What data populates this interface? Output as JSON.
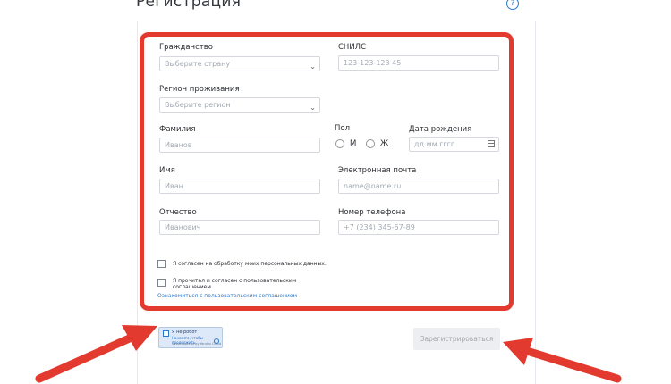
{
  "header": {
    "title": "Регистрация",
    "help_icon": "question-circle-icon",
    "help_glyph": "?"
  },
  "form": {
    "citizenship": {
      "label": "Гражданство",
      "placeholder": "Выберите страну"
    },
    "snils": {
      "label": "СНИЛС",
      "placeholder": "123-123-123 45"
    },
    "region": {
      "label": "Регион проживания",
      "placeholder": "Выберите регион"
    },
    "last_name": {
      "label": "Фамилия",
      "placeholder": "Иванов"
    },
    "gender": {
      "label": "Пол",
      "options": [
        "М",
        "Ж"
      ]
    },
    "birth_date": {
      "label": "Дата рождения",
      "placeholder": "дд.мм.гггг"
    },
    "first_name": {
      "label": "Имя",
      "placeholder": "Иван"
    },
    "email": {
      "label": "Электронная почта",
      "placeholder": "name@name.ru"
    },
    "middle_name": {
      "label": "Отчество",
      "placeholder": "Иванович"
    },
    "phone": {
      "label": "Номер телефона",
      "placeholder": "+7 (234) 345-67-89"
    },
    "consent_personal": "Я согласен на обработку моих персональных данных.",
    "consent_terms_line1": "Я прочитал и согласен с пользовательским",
    "consent_terms_line2": "соглашением.",
    "terms_link": "Ознакомиться с пользовательским соглашением"
  },
  "captcha": {
    "label": "Я не робот",
    "link": "Нажмите, чтобы продолжить",
    "footer": "SmartCaptcha by Yandex Cloud"
  },
  "actions": {
    "register_label": "Зарегистрироваться"
  },
  "colors": {
    "highlight": "#e23a2e",
    "accent": "#2a78c9"
  }
}
